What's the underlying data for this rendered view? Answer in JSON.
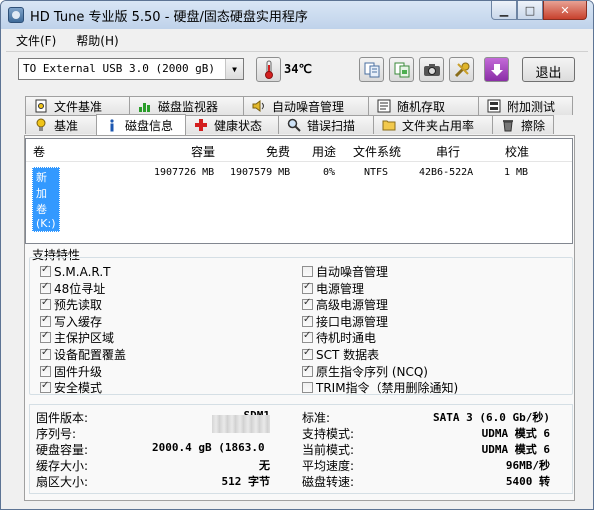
{
  "window": {
    "title": "HD Tune 专业版 5.50 - 硬盘/固态硬盘实用程序"
  },
  "menu": {
    "file": "文件(F)",
    "help": "帮助(H)"
  },
  "toolbar": {
    "drive": "TO External USB 3.0 (2000 gB)",
    "temperature": "34℃",
    "exit_label": "退出"
  },
  "tabs": {
    "row1": [
      {
        "label": "文件基准",
        "icon": "file-benchmark-icon"
      },
      {
        "label": "磁盘监视器",
        "icon": "disk-monitor-icon"
      },
      {
        "label": "自动噪音管理",
        "icon": "speaker-icon"
      },
      {
        "label": "随机存取",
        "icon": "random-access-icon"
      },
      {
        "label": "附加测试",
        "icon": "extra-tests-icon"
      }
    ],
    "row2": [
      {
        "label": "基准",
        "icon": "benchmark-icon"
      },
      {
        "label": "磁盘信息",
        "icon": "info-icon"
      },
      {
        "label": "健康状态",
        "icon": "health-icon"
      },
      {
        "label": "错误扫描",
        "icon": "error-scan-icon"
      },
      {
        "label": "文件夹占用率",
        "icon": "folder-icon"
      },
      {
        "label": "擦除",
        "icon": "erase-icon"
      }
    ]
  },
  "volumes": {
    "headers": [
      "卷",
      "容量",
      "免费",
      "用途",
      "文件系统",
      "串行",
      "校准"
    ],
    "rows": [
      {
        "name": "新加卷 (K:)",
        "capacity": "1907726 MB",
        "free": "1907579 MB",
        "usage": "0%",
        "fs": "NTFS",
        "serial": "42B6-522A",
        "align": "1 MB"
      }
    ]
  },
  "features": {
    "title": "支持特性",
    "left": [
      {
        "label": "S.M.A.R.T",
        "checked": true
      },
      {
        "label": "48位寻址",
        "checked": true
      },
      {
        "label": "预先读取",
        "checked": true
      },
      {
        "label": "写入缓存",
        "checked": true
      },
      {
        "label": "主保护区域",
        "checked": true
      },
      {
        "label": "设备配置覆盖",
        "checked": true
      },
      {
        "label": "固件升级",
        "checked": true
      },
      {
        "label": "安全模式",
        "checked": true
      }
    ],
    "right": [
      {
        "label": "自动噪音管理",
        "checked": false
      },
      {
        "label": "电源管理",
        "checked": true
      },
      {
        "label": "高级电源管理",
        "checked": true
      },
      {
        "label": "接口电源管理",
        "checked": true
      },
      {
        "label": "待机时通电",
        "checked": true
      },
      {
        "label": "SCT 数据表",
        "checked": true
      },
      {
        "label": "原生指令序列 (NCQ)",
        "checked": true
      },
      {
        "label": "TRIM指令（禁用删除通知)",
        "checked": false
      }
    ]
  },
  "info": {
    "left": [
      {
        "label": "固件版本:",
        "value": "SDM1"
      },
      {
        "label": "序列号:",
        "value": ""
      },
      {
        "label": "硬盘容量:",
        "value": "2000.4 gB (1863.0"
      },
      {
        "label": "缓存大小:",
        "value": "无"
      },
      {
        "label": "扇区大小:",
        "value": "512 字节"
      }
    ],
    "right": [
      {
        "label": "标准:",
        "value": "SATA 3 (6.0 Gb/秒)"
      },
      {
        "label": "支持模式:",
        "value": "UDMA 模式 6"
      },
      {
        "label": "当前模式:",
        "value": "UDMA 模式 6"
      },
      {
        "label": "平均速度:",
        "value": "96MB/秒"
      },
      {
        "label": "磁盘转速:",
        "value": "5400 转"
      }
    ]
  }
}
